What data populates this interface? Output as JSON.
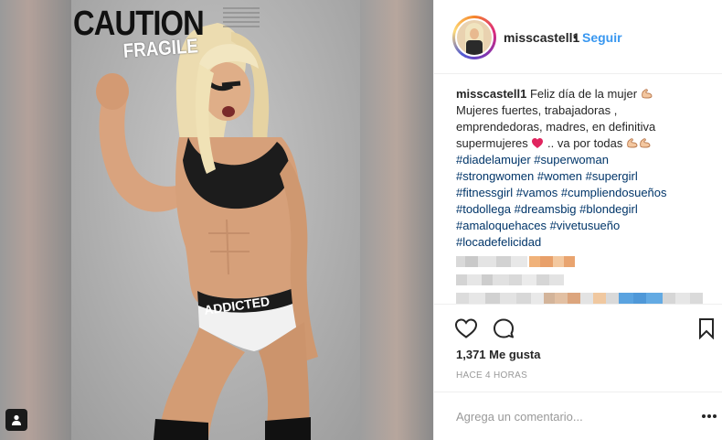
{
  "media": {
    "caution_text": "CAUTION",
    "fragile_text": "FRAGILE",
    "shorts_text": "ADDICTED"
  },
  "header": {
    "username": "misscastell1",
    "separator": "•",
    "follow_label": "Seguir"
  },
  "caption": {
    "username": "misscastell1",
    "line1_text": "Feliz día de la mujer",
    "line2": "Mujeres fuertes, trabajadoras ,",
    "line3": "emprendedoras, madres, en definitiva",
    "line4_a": "supermujeres",
    "line4_b": ".. va por todas",
    "hashtag_lines": [
      "#diadelamujer #superwoman",
      "#strongwomen #women #supergirl",
      "#fitnessgirl #vamos #cumpliendosueños",
      "#todollega #dreamsbig #blondegirl",
      "#amaloquehaces #vivetusueño",
      "#locadefelicidad"
    ]
  },
  "icons": {
    "multi_photo": "user-square-icon",
    "like": "heart-outline-icon",
    "comment": "speech-bubble-icon",
    "save": "bookmark-icon",
    "more": "more-options-icon",
    "emoji_flex": "flexed-biceps-emoji",
    "emoji_heart": "red-heart-emoji"
  },
  "colors": {
    "link_blue": "#3897f0",
    "hashtag": "#003569",
    "heart_red": "#e0245e",
    "text": "#262626",
    "muted": "#999999"
  },
  "stats": {
    "likes": "1,371 Me gusta",
    "time": "HACE 4 HORAS"
  },
  "comment": {
    "placeholder": "Agrega un comentario..."
  }
}
